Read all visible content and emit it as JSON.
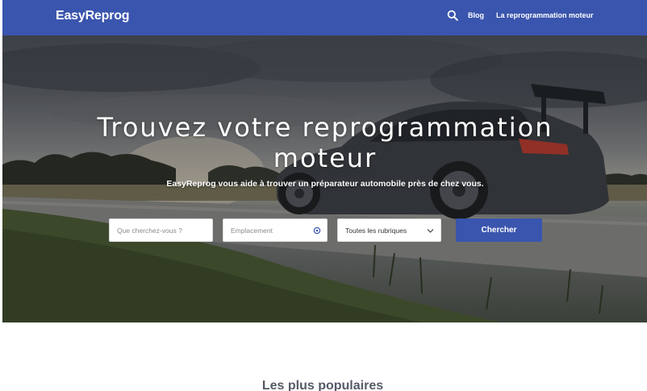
{
  "header": {
    "logo": "EasyReprog",
    "nav": [
      "Blog",
      "La reprogrammation moteur"
    ],
    "search_icon": "search-icon"
  },
  "hero": {
    "title": "Trouvez votre reprogrammation moteur",
    "subtitle": "EasyReprog vous aide à trouver un préparateur automobile près de chez vous."
  },
  "search": {
    "query_placeholder": "Que cherchez-vous ?",
    "location_placeholder": "Emplacement",
    "location_icon": "crosshair-icon",
    "category_selected": "Toutes les rubriques",
    "category_icon": "chevron-down-icon",
    "submit_label": "Chercher"
  },
  "popular": {
    "title": "Les plus populaires"
  },
  "colors": {
    "brand": "#3a55ad"
  }
}
